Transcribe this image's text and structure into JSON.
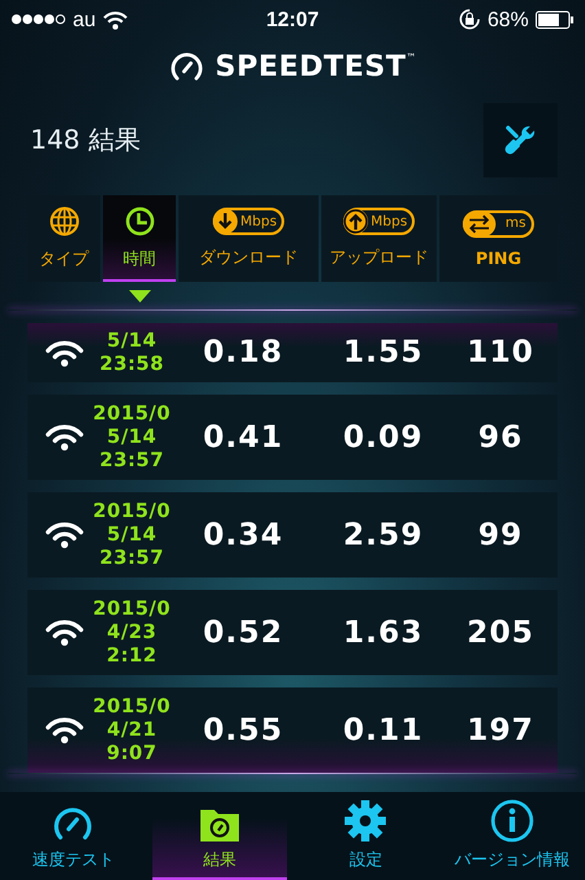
{
  "status_bar": {
    "carrier": "au",
    "time": "12:07",
    "battery": "68%"
  },
  "app": {
    "logo": "SPEEDTEST",
    "trademark": "™"
  },
  "results": {
    "count_label": "148 結果"
  },
  "columns": [
    {
      "kind": "type",
      "label": "タイプ",
      "selected": false
    },
    {
      "kind": "time",
      "label": "時間",
      "selected": true
    },
    {
      "kind": "download",
      "unit": "Mbps",
      "label": "ダウンロード",
      "selected": false
    },
    {
      "kind": "upload",
      "unit": "Mbps",
      "label": "アップロード",
      "selected": false
    },
    {
      "kind": "ping",
      "unit": "ms",
      "label": "PING",
      "selected": false
    }
  ],
  "rows": [
    {
      "time": [
        "5/14",
        "23:58"
      ],
      "download": "0.18",
      "upload": "1.55",
      "ping": "110"
    },
    {
      "time": [
        "2015/0",
        "5/14",
        "23:57"
      ],
      "download": "0.41",
      "upload": "0.09",
      "ping": "96"
    },
    {
      "time": [
        "2015/0",
        "5/14",
        "23:57"
      ],
      "download": "0.34",
      "upload": "2.59",
      "ping": "99"
    },
    {
      "time": [
        "2015/0",
        "4/23",
        "2:12"
      ],
      "download": "0.52",
      "upload": "1.63",
      "ping": "205"
    },
    {
      "time": [
        "2015/0",
        "4/21",
        "9:07"
      ],
      "download": "0.55",
      "upload": "0.11",
      "ping": "197"
    }
  ],
  "tabs": [
    {
      "kind": "speedtest",
      "label": "速度テスト",
      "selected": false
    },
    {
      "kind": "results",
      "label": "結果",
      "selected": true
    },
    {
      "kind": "settings",
      "label": "設定",
      "selected": false
    },
    {
      "kind": "info",
      "label": "バージョン情報",
      "selected": false
    }
  ]
}
